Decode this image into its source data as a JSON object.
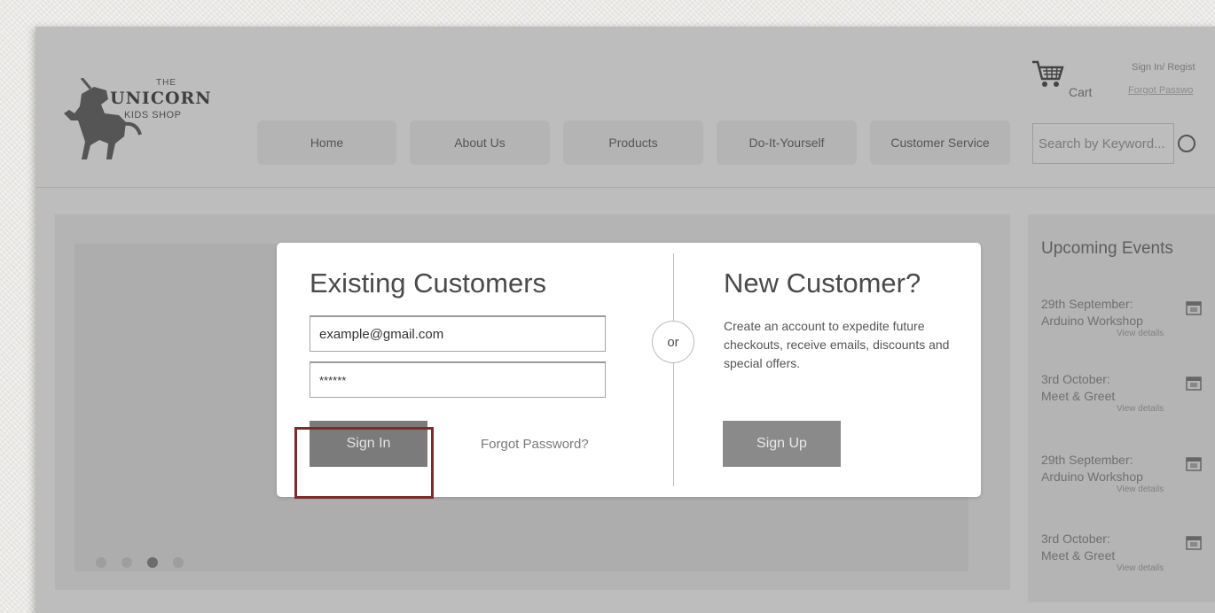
{
  "logo": {
    "line1": "THE",
    "line2": "UNICORN",
    "line3": "KIDS SHOP"
  },
  "nav": [
    {
      "label": "Home"
    },
    {
      "label": "About Us"
    },
    {
      "label": "Products"
    },
    {
      "label": "Do-It-Yourself"
    },
    {
      "label": "Customer Service"
    }
  ],
  "header": {
    "cart_label": "Cart",
    "signin_register": "Sign In/ Regist",
    "forgot_password": "Forgot Passwo",
    "search_placeholder": "Search by Keyword..."
  },
  "carousel": {
    "dots": 4,
    "active_dot_index": 2
  },
  "events": {
    "title": "Upcoming Events",
    "items": [
      {
        "line1": "29th September:",
        "line2": "Arduino Workshop",
        "link": "View details"
      },
      {
        "line1": "3rd October:",
        "line2": "Meet & Greet",
        "link": "View details"
      },
      {
        "line1": "29th September:",
        "line2": "Arduino Workshop",
        "link": "View details"
      },
      {
        "line1": "3rd October:",
        "line2": "Meet & Greet",
        "link": "View details"
      }
    ]
  },
  "modal": {
    "existing_title": "Existing Customers",
    "email_value": "example@gmail.com",
    "password_value": "******",
    "signin_label": "Sign In",
    "forgot_label": "Forgot Password?",
    "or_label": "or",
    "new_title": "New Customer?",
    "new_description": "Create an account to expedite future checkouts, receive emails, discounts and special offers.",
    "signup_label": "Sign Up"
  },
  "colors": {
    "backdrop": "#bdbdbd",
    "modal_bg": "#ffffff",
    "button": "#7b7b7b",
    "highlight": "#7f2a2a"
  }
}
